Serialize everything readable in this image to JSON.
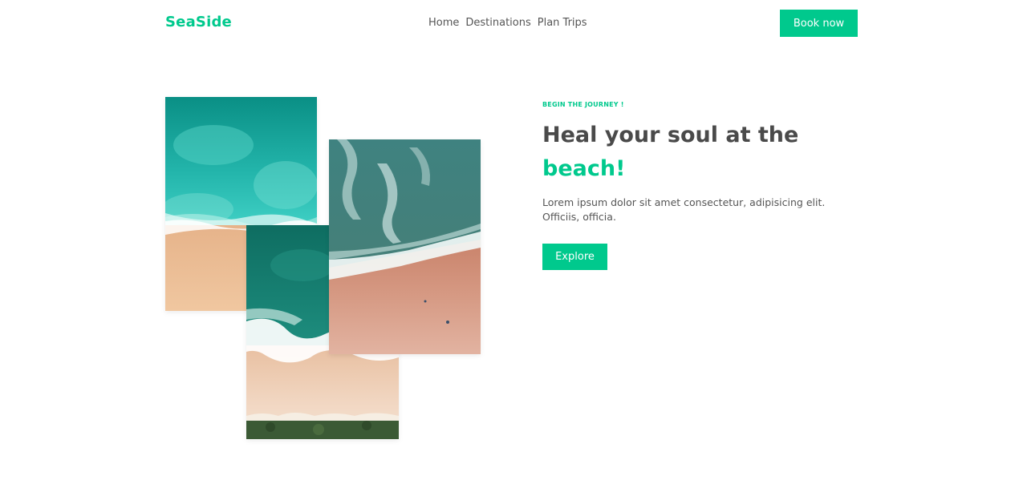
{
  "header": {
    "logo": "SeaSide",
    "nav": [
      {
        "label": "Home"
      },
      {
        "label": "Destinations"
      },
      {
        "label": "Plan Trips"
      }
    ],
    "book_label": "Book now"
  },
  "hero": {
    "eyebrow": "BEGIN THE JOURNEY !",
    "headline_part1": "Heal your soul at the",
    "headline_accent": "beach!",
    "description": "Lorem ipsum dolor sit amet consectetur, adipisicing elit. Officiis, officia.",
    "explore_label": "Explore"
  },
  "colors": {
    "accent": "#00c98d",
    "text": "#4a4a4a"
  }
}
